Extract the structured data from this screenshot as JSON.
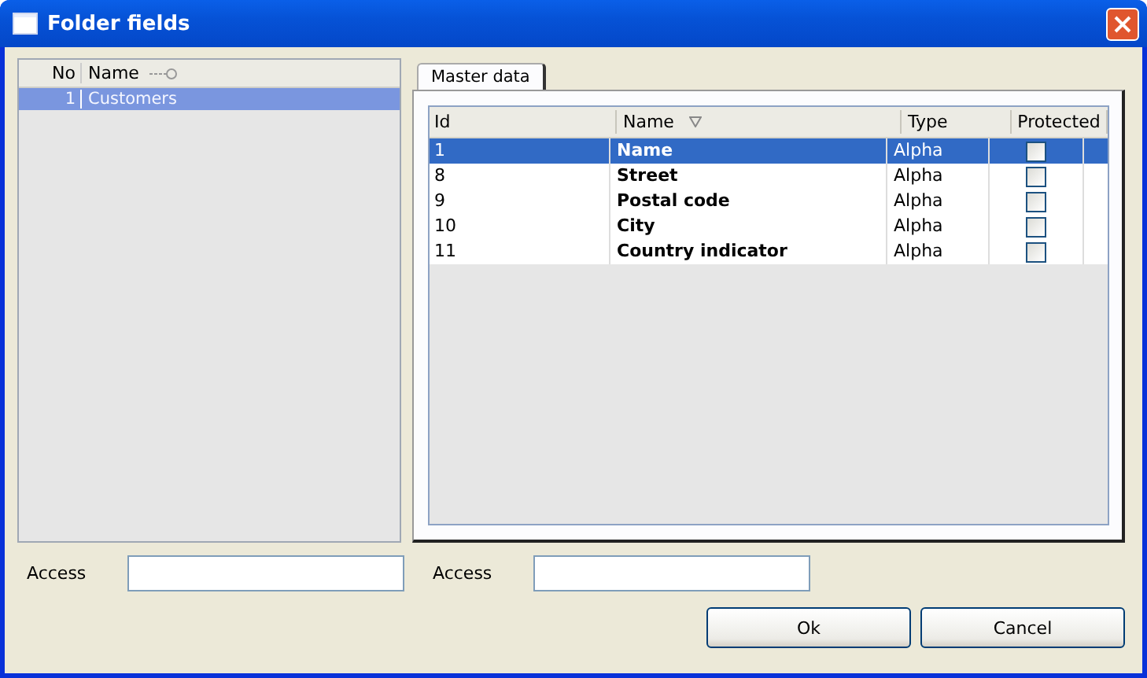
{
  "window": {
    "title": "Folder fields"
  },
  "folders": {
    "columns": [
      "No",
      "Name"
    ],
    "rows": [
      {
        "no": "1",
        "name": "Customers",
        "selected": true
      }
    ]
  },
  "tabs": [
    {
      "label": "Master data",
      "selected": true
    }
  ],
  "fields": {
    "columns": [
      "Id",
      "Name",
      "Type",
      "Protected"
    ],
    "rows": [
      {
        "id": "1",
        "name": "Name",
        "type": "Alpha",
        "protected": false,
        "selected": true
      },
      {
        "id": "8",
        "name": "Street",
        "type": "Alpha",
        "protected": false,
        "selected": false
      },
      {
        "id": "9",
        "name": "Postal code",
        "type": "Alpha",
        "protected": false,
        "selected": false
      },
      {
        "id": "10",
        "name": "City",
        "type": "Alpha",
        "protected": false,
        "selected": false
      },
      {
        "id": "11",
        "name": "Country indicator",
        "type": "Alpha",
        "protected": false,
        "selected": false
      }
    ]
  },
  "access_fields": [
    {
      "label": "Access"
    },
    {
      "label": "Access"
    }
  ],
  "buttons": [
    "Ok",
    "Cancel"
  ]
}
